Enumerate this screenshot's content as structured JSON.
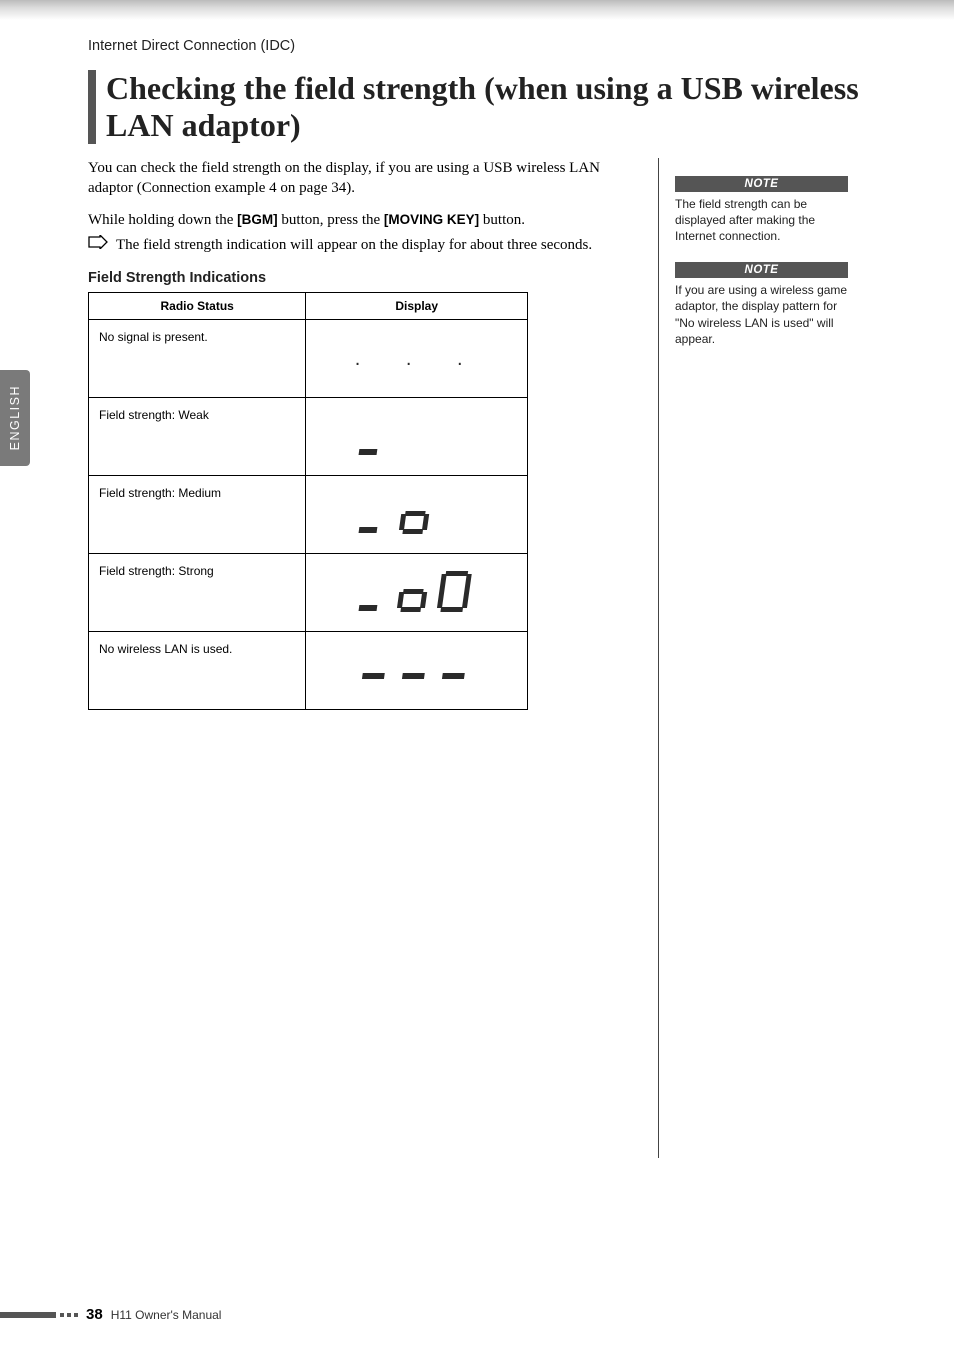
{
  "side_tab": {
    "label": "ENGLISH"
  },
  "breadcrumb": "Internet Direct Connection (IDC)",
  "headline": "Checking the field strength (when using a USB wireless LAN adaptor)",
  "intro": "You can check the field strength on the display, if you are using a USB wireless LAN adaptor (Connection example 4 on page 34).",
  "instruction": {
    "pre": "While holding down the ",
    "btn1": "[BGM]",
    "mid": " button, press the ",
    "btn2": "[MOVING KEY]",
    "post": " button."
  },
  "result_line": "The field strength indication will appear on the display for about three seconds.",
  "subhead": "Field Strength Indications",
  "table": {
    "head_status": "Radio Status",
    "head_display": "Display",
    "rows": [
      {
        "status": "No signal is present.",
        "display_kind": "dots"
      },
      {
        "status": "Field strength: Weak",
        "display_kind": "weak"
      },
      {
        "status": "Field strength: Medium",
        "display_kind": "medium"
      },
      {
        "status": "Field strength: Strong",
        "display_kind": "strong"
      },
      {
        "status": "No wireless LAN is used.",
        "display_kind": "none"
      }
    ]
  },
  "notes": [
    {
      "title": "NOTE",
      "body": "The field strength can be displayed after making the Internet connection."
    },
    {
      "title": "NOTE",
      "body": "If you are using a wireless game adaptor, the display pattern for \"No wireless LAN is used\" will appear."
    }
  ],
  "footer": {
    "page": "38",
    "title": "H11 Owner's Manual"
  }
}
